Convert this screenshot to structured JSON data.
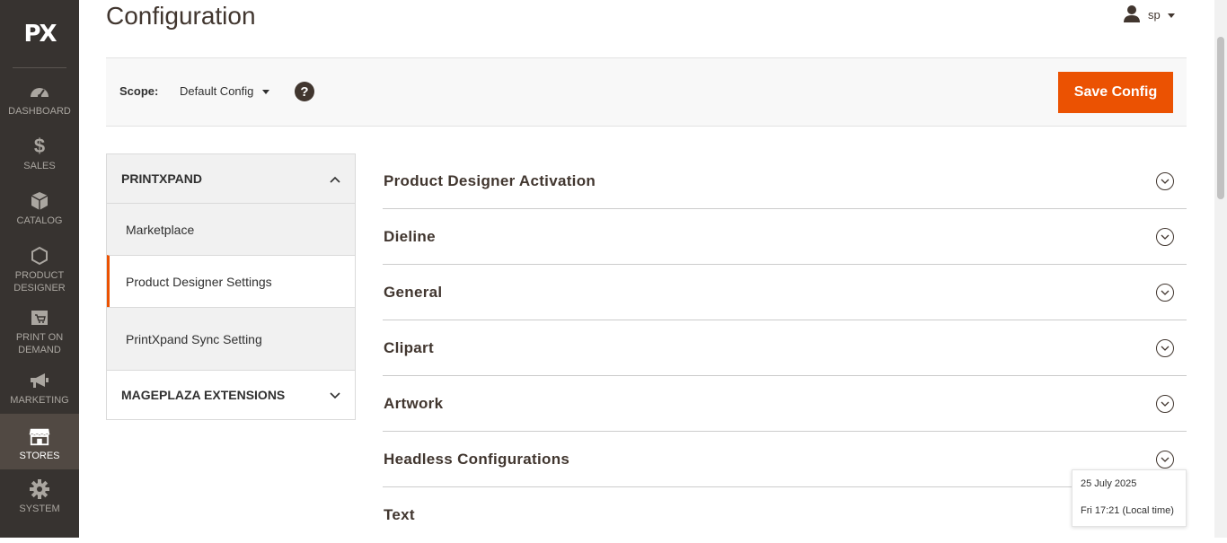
{
  "nav": {
    "logo": "PX",
    "items": [
      {
        "label": "DASHBOARD",
        "icon": "dashboard-icon"
      },
      {
        "label": "SALES",
        "icon": "dollar-icon"
      },
      {
        "label": "CATALOG",
        "icon": "box-icon"
      },
      {
        "label": "PRODUCT DESIGNER",
        "icon": "hexagon-icon"
      },
      {
        "label": "PRINT ON DEMAND",
        "icon": "print-cart-icon"
      },
      {
        "label": "MARKETING",
        "icon": "megaphone-icon"
      },
      {
        "label": "STORES",
        "icon": "store-icon",
        "active": true
      },
      {
        "label": "SYSTEM",
        "icon": "gear-icon"
      }
    ]
  },
  "header": {
    "title": "Configuration",
    "user": "sp"
  },
  "scope": {
    "label": "Scope:",
    "value": "Default Config",
    "help": "?"
  },
  "actions": {
    "save_label": "Save Config"
  },
  "tabs": {
    "group1": {
      "title": "PRINTXPAND",
      "items": [
        {
          "label": "Marketplace"
        },
        {
          "label": "Product Designer Settings",
          "active": true
        },
        {
          "label": "PrintXpand Sync Setting"
        }
      ]
    },
    "group2": {
      "title": "MAGEPLAZA EXTENSIONS"
    }
  },
  "sections": [
    {
      "title": "Product Designer Activation"
    },
    {
      "title": "Dieline"
    },
    {
      "title": "General"
    },
    {
      "title": "Clipart"
    },
    {
      "title": "Artwork"
    },
    {
      "title": "Headless Configurations"
    },
    {
      "title": "Text"
    }
  ],
  "tooltip": {
    "date": "25 July 2025",
    "time": "Fri 17:21 (Local time)"
  },
  "colors": {
    "nav_bg": "#373330",
    "nav_active": "#514943",
    "accent": "#eb5202",
    "title_text": "#41362f"
  }
}
